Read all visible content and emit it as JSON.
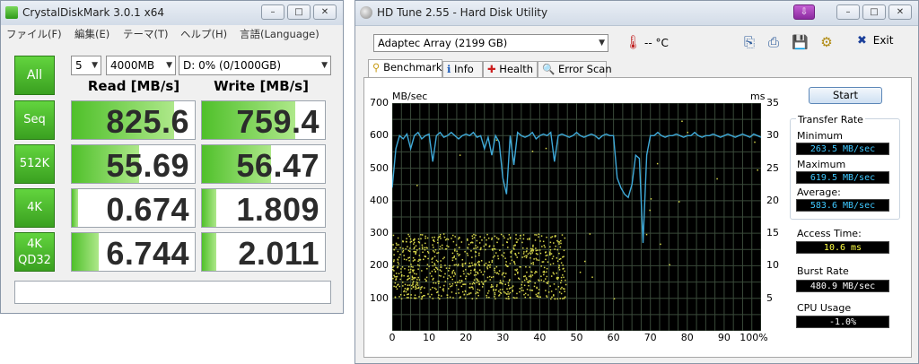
{
  "cdm": {
    "title": "CrystalDiskMark 3.0.1 x64",
    "menu": [
      "ファイル(F)",
      "編集(E)",
      "テーマ(T)",
      "ヘルプ(H)",
      "言語(Language)"
    ],
    "all_label": "All",
    "runs": "5",
    "size": "4000MB",
    "drive": "D: 0% (0/1000GB)",
    "read_header": "Read [MB/s]",
    "write_header": "Write [MB/s]",
    "rows": [
      {
        "label": "Seq",
        "read": "825.6",
        "write": "759.4",
        "read_fill": 0.83,
        "write_fill": 0.76
      },
      {
        "label": "512K",
        "read": "55.69",
        "write": "56.47",
        "read_fill": 0.55,
        "write_fill": 0.56
      },
      {
        "label": "4K",
        "read": "0.674",
        "write": "1.809",
        "read_fill": 0.05,
        "write_fill": 0.12
      },
      {
        "label_line1": "4K",
        "label_line2": "QD32",
        "read": "6.744",
        "write": "2.011",
        "read_fill": 0.22,
        "write_fill": 0.12
      }
    ],
    "comment": ""
  },
  "hdt": {
    "title": "HD Tune 2.55 - Hard Disk Utility",
    "drive": "Adaptec Array (2199 GB)",
    "temperature": "-- °C",
    "exit_label": "Exit",
    "tabs": [
      "Benchmark",
      "Info",
      "Health",
      "Error Scan"
    ],
    "start_label": "Start",
    "transfer_rate_title": "Transfer Rate",
    "minimum_label": "Minimum",
    "minimum_value": "263.5 MB/sec",
    "maximum_label": "Maximum",
    "maximum_value": "619.5 MB/sec",
    "average_label": "Average:",
    "average_value": "583.6 MB/sec",
    "access_time_label": "Access Time:",
    "access_time_value": "10.6 ms",
    "burst_rate_label": "Burst Rate",
    "burst_rate_value": "480.9 MB/sec",
    "cpu_usage_label": "CPU Usage",
    "cpu_usage_value": "-1.0%",
    "colors": {
      "transfer_line": "#3fa9d8",
      "access_points": "#d8d84a",
      "min_max_avg_text": "#3fc8ff",
      "access_text": "#ffff44",
      "burst_text": "#ffffff"
    }
  },
  "chart_data": {
    "type": "line",
    "y_left_unit": "MB/sec",
    "y_right_unit": "ms",
    "x_ticks": [
      "0",
      "10",
      "20",
      "30",
      "40",
      "50",
      "60",
      "70",
      "80",
      "90",
      "100%"
    ],
    "y_left_ticks": [
      "100",
      "200",
      "300",
      "400",
      "500",
      "600",
      "700"
    ],
    "y_right_ticks": [
      "5",
      "10",
      "15",
      "20",
      "25",
      "30",
      "35"
    ],
    "xlim": [
      0,
      100
    ],
    "ylim_left": [
      0,
      700
    ],
    "ylim_right": [
      0,
      35
    ],
    "grid": true,
    "series": [
      {
        "x": [
          0,
          1,
          2,
          3,
          4,
          5,
          6,
          7,
          8,
          9,
          10,
          11,
          12,
          13,
          14,
          15,
          16,
          17,
          18,
          19,
          20,
          21,
          22,
          23,
          24,
          25,
          26,
          27,
          28,
          29,
          30,
          31,
          32,
          33,
          34,
          35,
          36,
          37,
          38,
          39,
          40,
          41,
          42,
          43,
          44,
          45,
          46,
          47,
          48,
          49,
          50,
          51,
          52,
          53,
          54,
          55,
          56,
          57,
          58,
          59,
          60,
          61,
          62,
          63,
          64,
          65,
          66,
          67,
          68,
          69,
          70,
          71,
          72,
          73,
          74,
          75,
          76,
          77,
          78,
          79,
          80,
          81,
          82,
          83,
          84,
          85,
          86,
          87,
          88,
          89,
          90,
          91,
          92,
          93,
          94,
          95,
          96,
          97,
          98,
          99,
          100
        ],
        "y": [
          440,
          560,
          600,
          590,
          605,
          560,
          600,
          610,
          590,
          600,
          605,
          520,
          600,
          610,
          595,
          600,
          610,
          600,
          590,
          600,
          605,
          600,
          610,
          595,
          600,
          560,
          595,
          540,
          600,
          580,
          470,
          420,
          600,
          510,
          610,
          600,
          595,
          600,
          610,
          590,
          600,
          605,
          600,
          610,
          520,
          600,
          605,
          600,
          595,
          600,
          610,
          600,
          595,
          600,
          605,
          600,
          590,
          600,
          605,
          600,
          600,
          470,
          440,
          420,
          410,
          450,
          540,
          530,
          270,
          540,
          600,
          600,
          610,
          600,
          595,
          600,
          600,
          605,
          600,
          595,
          600,
          600,
          610,
          600,
          595,
          600,
          600,
          605,
          600,
          595,
          600,
          605,
          600,
          595,
          600,
          605,
          600,
          595,
          605,
          600,
          595
        ]
      }
    ]
  }
}
